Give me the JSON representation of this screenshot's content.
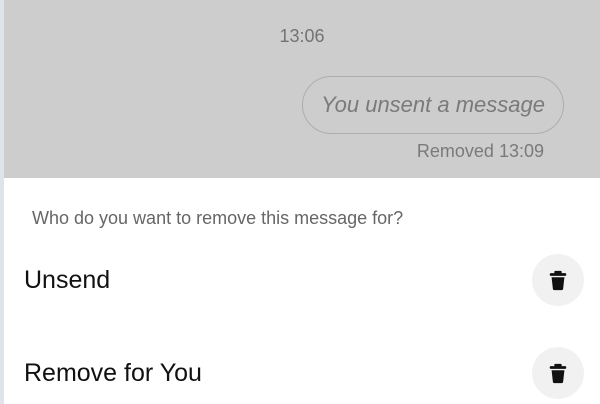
{
  "chat": {
    "timestamp": "13:06",
    "unsent_text": "You unsent a message",
    "removed_text": "Removed 13:09"
  },
  "sheet": {
    "question": "Who do you want to remove this message for?",
    "options": [
      {
        "label": "Unsend",
        "icon": "trash-icon"
      },
      {
        "label": "Remove for You",
        "icon": "trash-icon"
      }
    ]
  }
}
